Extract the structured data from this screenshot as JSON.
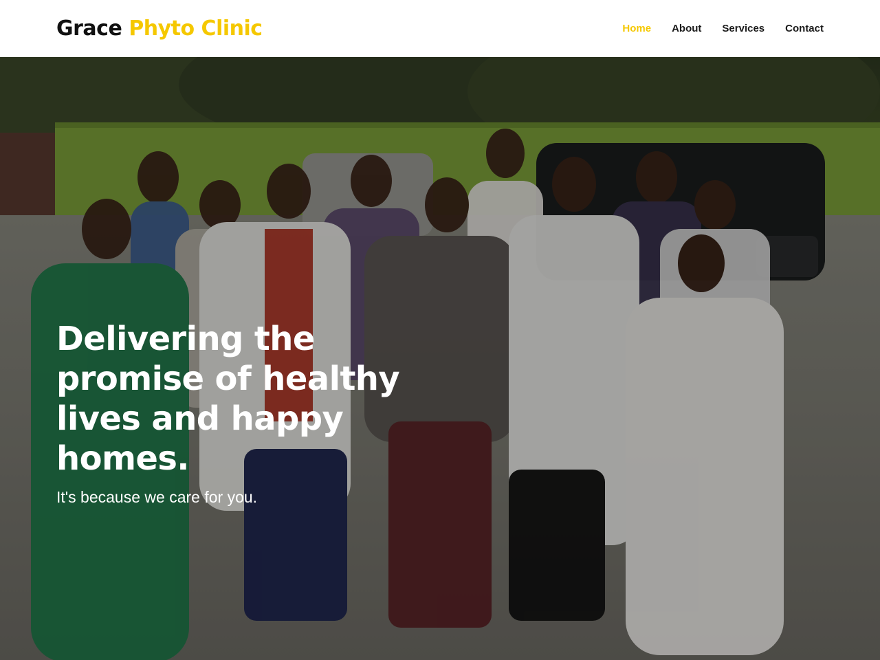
{
  "header": {
    "brand_primary": "Grace",
    "brand_accent": "Phyto Clinic",
    "nav": [
      {
        "label": "Home",
        "active": true
      },
      {
        "label": "About",
        "active": false
      },
      {
        "label": "Services",
        "active": false
      },
      {
        "label": "Contact",
        "active": false
      }
    ]
  },
  "hero": {
    "title": "Delivering the promise of healthy lives and happy homes.",
    "subtitle": "It's because we care for you."
  },
  "colors": {
    "accent": "#f5c800",
    "text_dark": "#1a1a1a",
    "hero_text": "#ffffff"
  }
}
